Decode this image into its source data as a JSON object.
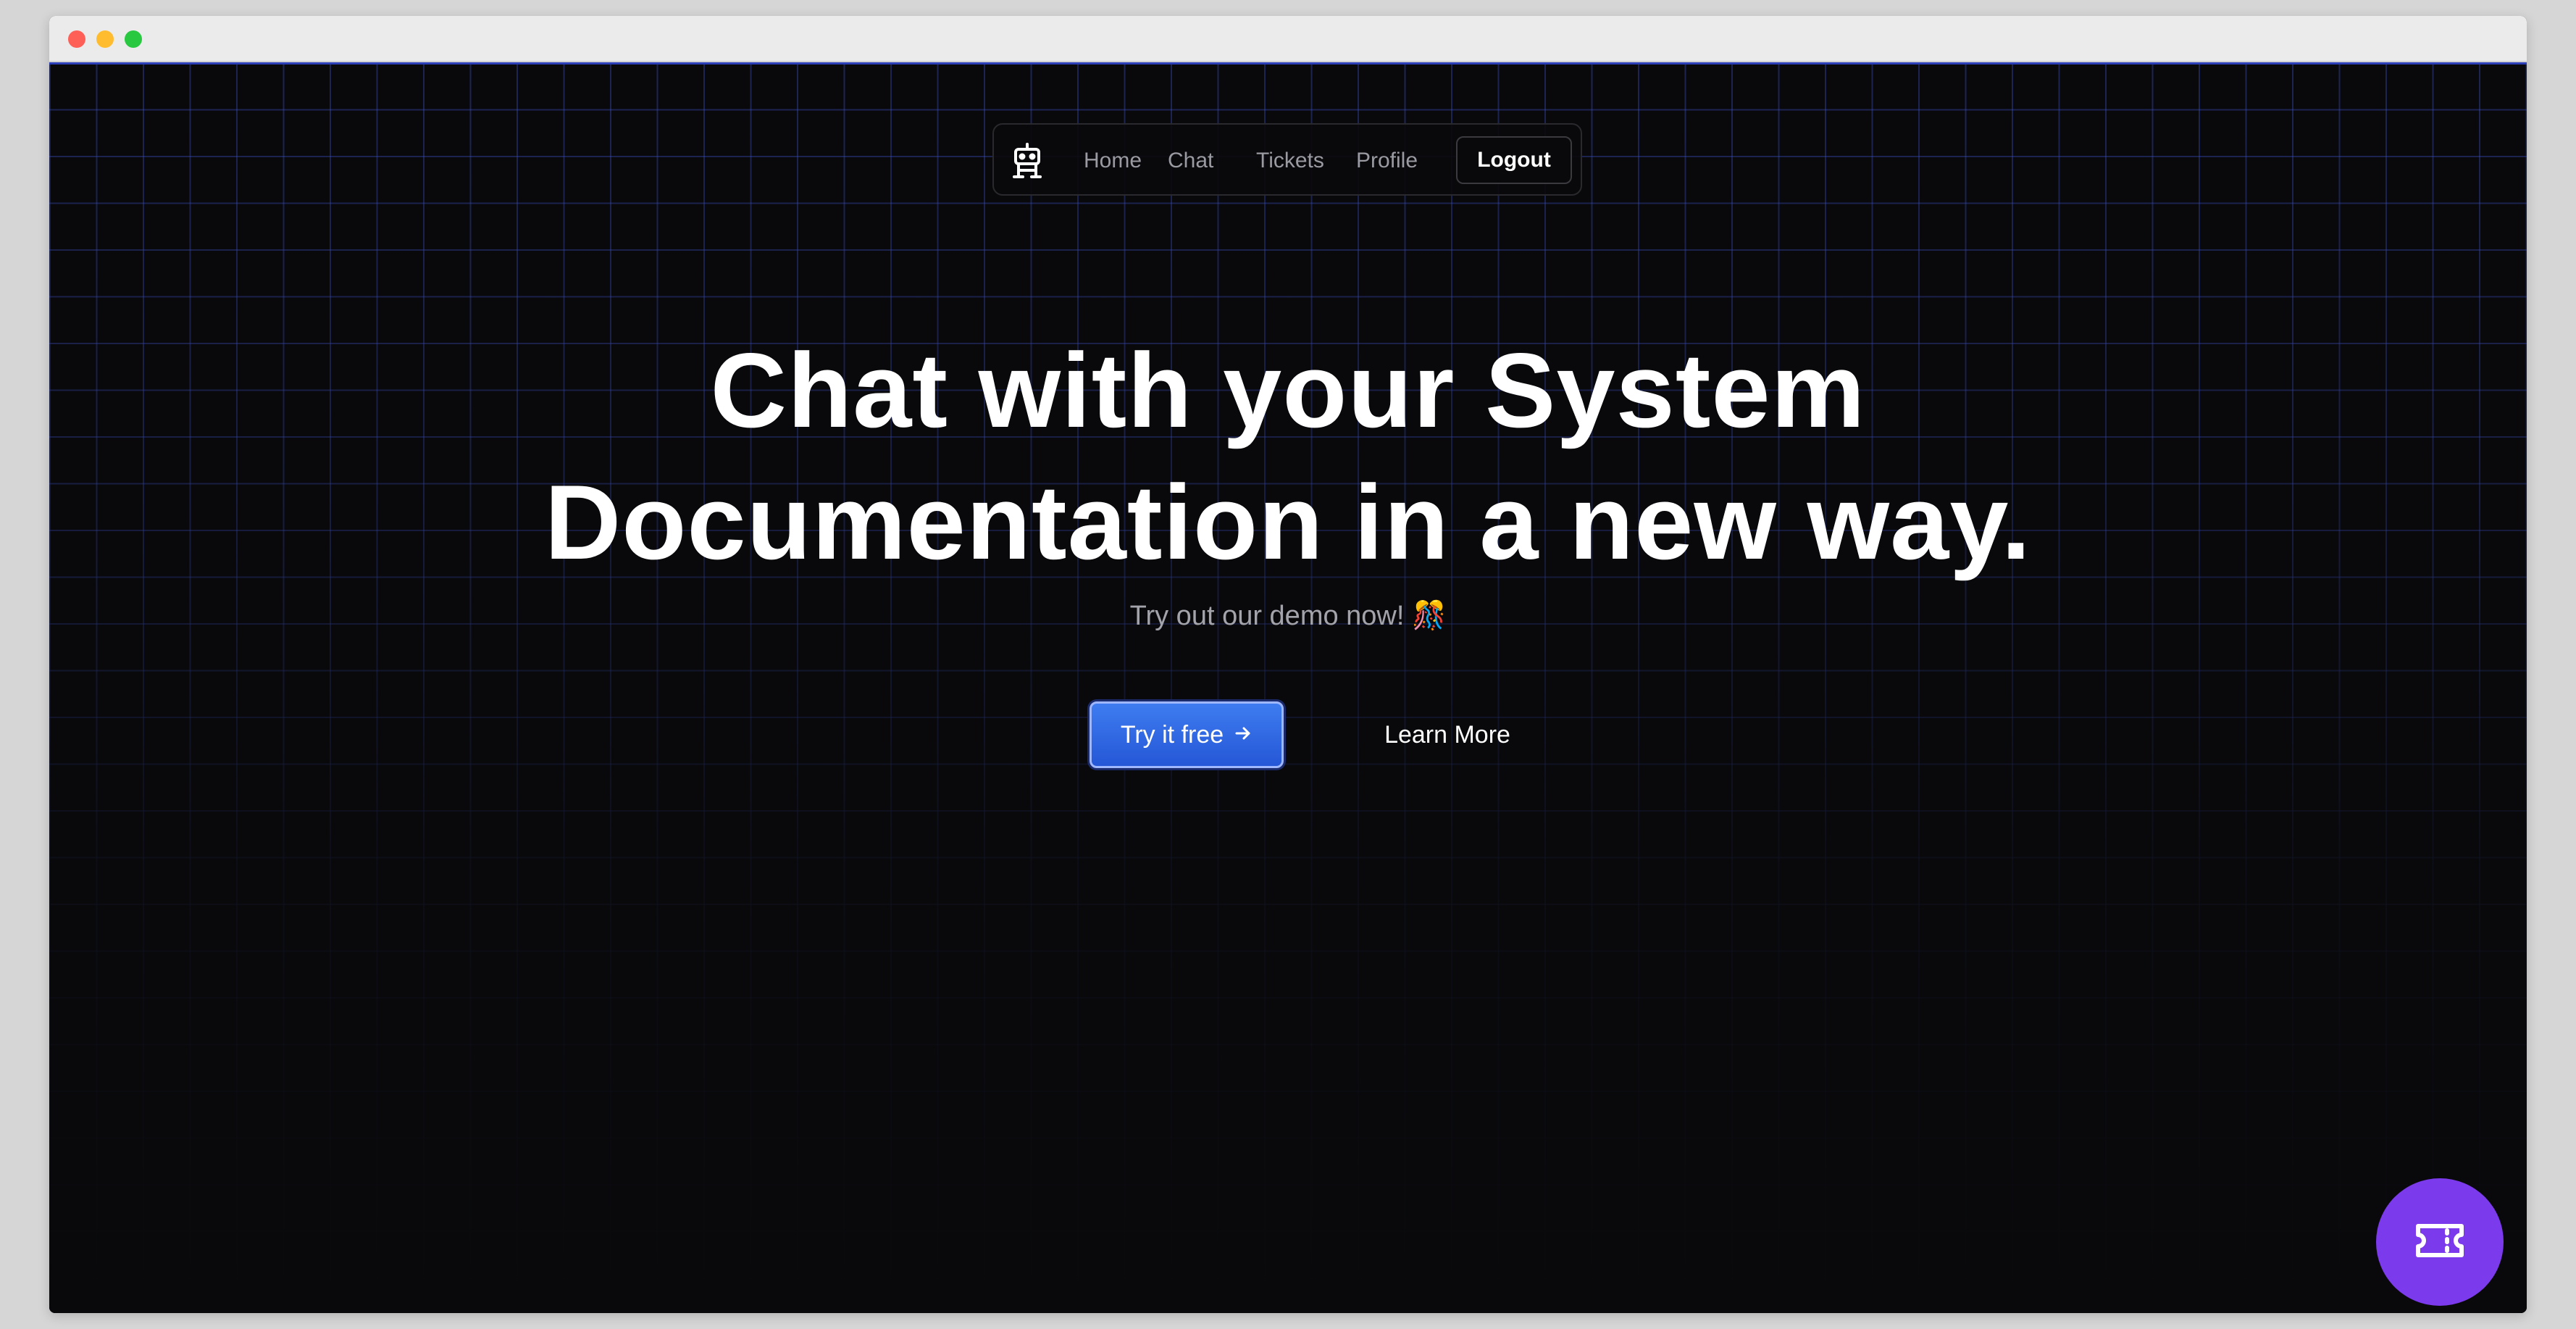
{
  "browser": {
    "buttons": [
      "close",
      "minimize",
      "zoom"
    ]
  },
  "navbar": {
    "logo_icon": "robot-icon",
    "links": [
      {
        "label": "Home"
      },
      {
        "label": "Chat"
      },
      {
        "label": "Tickets"
      },
      {
        "label": "Profile"
      }
    ],
    "logout_label": "Logout"
  },
  "hero": {
    "title_line1": "Chat with your System",
    "title_line2": "Documentation in a new way.",
    "subtitle": "Try out our demo now! 🎊",
    "primary_cta": "Try it free",
    "primary_cta_icon": "arrow-right-icon",
    "secondary_cta": "Learn More"
  },
  "fab": {
    "icon": "ticket-icon"
  },
  "colors": {
    "background": "#09090b",
    "grid": "#3c50c8",
    "primary_button": "#2f6ae6",
    "fab": "#7c3aed",
    "text": "#ffffff",
    "muted_text": "#a3a3ab"
  }
}
